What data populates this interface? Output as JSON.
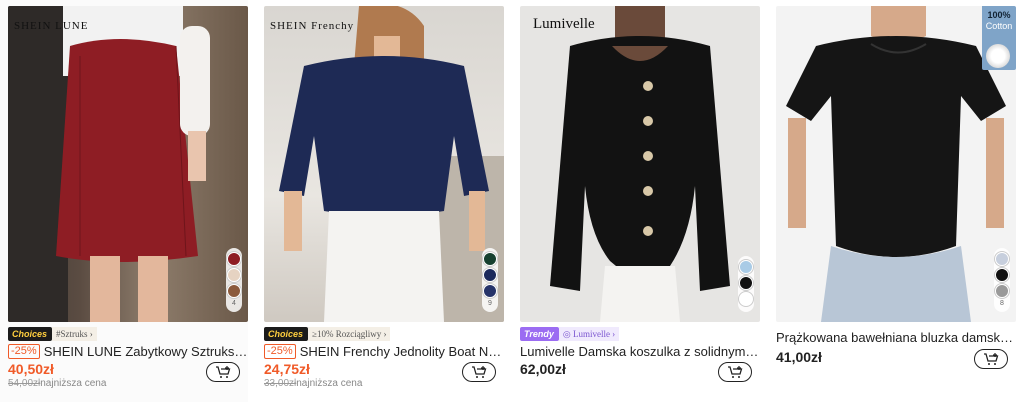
{
  "products": [
    {
      "brand_logo": "SHEIN LUNE",
      "swatches": [
        "#8e1d24",
        "#e6d3c2",
        "#8b5a3c"
      ],
      "swatch_count": "4",
      "tag_label": "Choices",
      "tag_sub": "#Sztruks ›",
      "discount": "-25%",
      "title": "SHEIN LUNE Zabytkowy Sztruks Wy...",
      "price": "40,50zł",
      "old_price": "54,00zł",
      "low_label": "najniższa cena",
      "price_red": true
    },
    {
      "brand_logo": "SHEIN Frenchy",
      "swatches": [
        "#16402f",
        "#1c2a5c",
        "#26346a"
      ],
      "swatch_count": "9",
      "tag_label": "Choices",
      "tag_sub": "≥10% Rozciągliwy ›",
      "discount": "-25%",
      "title": "SHEIN Frenchy Jednolity Boat Neck ...",
      "price": "24,75zł",
      "old_price": "33,00zł",
      "low_label": "najniższa cena",
      "price_red": true
    },
    {
      "brand_logo": "Lumivelle",
      "swatches": [
        "#a9cbe6",
        "#111111",
        "#ffffff"
      ],
      "swatch_count": "",
      "tag_label": "Trendy",
      "tag_sub": "◎ Lumivelle ›",
      "discount": "",
      "title": "Lumivelle Damska koszulka z solidnym me...",
      "price": "62,00zł",
      "old_price": "",
      "low_label": "",
      "price_red": false
    },
    {
      "brand_logo": "",
      "badge_line1": "100%",
      "badge_line2": "Cotton",
      "swatches": [
        "#c7cfdd",
        "#111111",
        "#9a9a9a"
      ],
      "swatch_count": "8",
      "tag_label": "",
      "tag_sub": "",
      "discount": "",
      "title": "Prążkowana bawełniana bluzka damska z ...",
      "price": "41,00zł",
      "old_price": "",
      "low_label": "",
      "price_red": false
    }
  ],
  "icons": {
    "cart": "add-to-cart-icon"
  }
}
